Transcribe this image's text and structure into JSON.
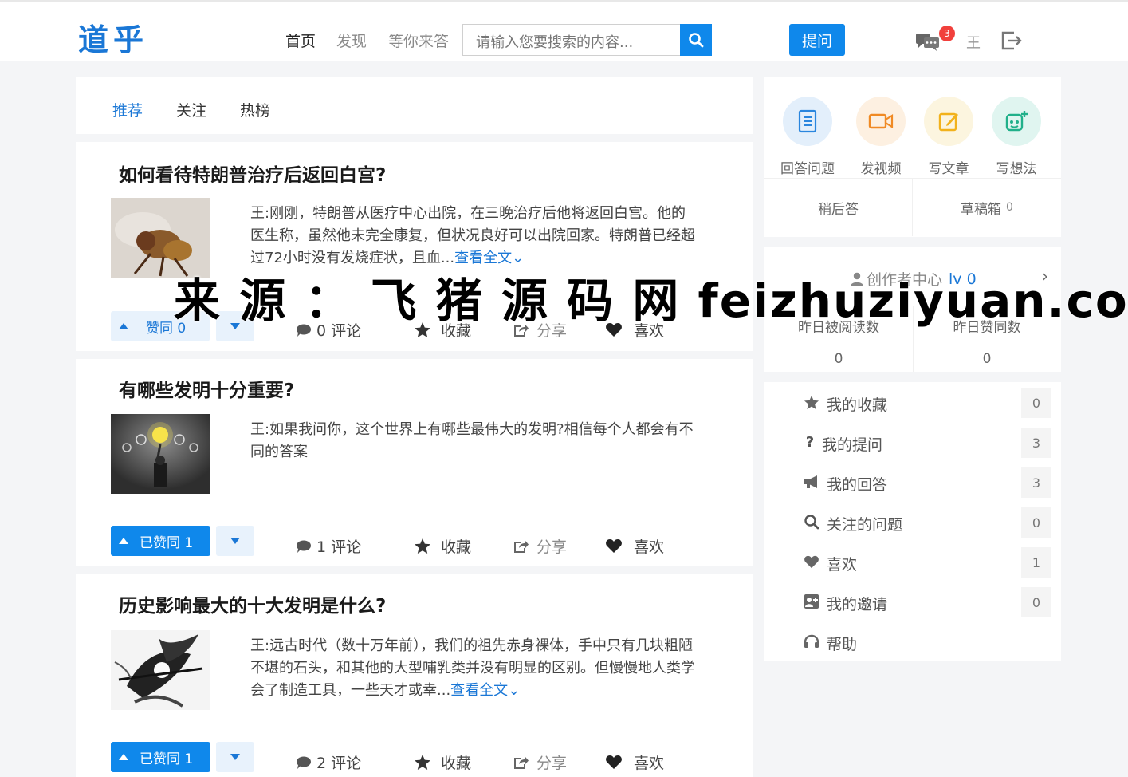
{
  "header": {
    "logo": "道乎",
    "nav": [
      "首页",
      "发现",
      "等你来答"
    ],
    "search_placeholder": "请输入您要搜索的内容...",
    "ask_label": "提问",
    "message_count": "3",
    "user_name": "王"
  },
  "tabs": [
    "推荐",
    "关注",
    "热榜"
  ],
  "questions": [
    {
      "title": "如何看待特朗普治疗后返回白宫?",
      "excerpt": "王:刚刚，特朗普从医疗中心出院，在三晚治疗后他将返回白宫。他的医生称，虽然他未完全康复，但状况良好可以出院回家。特朗普已经超过72小时没有发烧症状，且血...",
      "read_more": "查看全文",
      "vote_label": "赞同 0",
      "comments": "0 评论",
      "collect": "收藏",
      "share": "分享",
      "like": "喜欢"
    },
    {
      "title": "有哪些发明十分重要?",
      "excerpt": "王:如果我问你，这个世界上有哪些最伟大的发明?相信每个人都会有不同的答案",
      "read_more": "",
      "vote_label": "已赞同 1",
      "comments": "1 评论",
      "collect": "收藏",
      "share": "分享",
      "like": "喜欢"
    },
    {
      "title": "历史影响最大的十大发明是什么?",
      "excerpt": "王:远古时代（数十万年前），我们的祖先赤身裸体，手中只有几块粗陋不堪的石头，和其他的大型哺乳类并没有明显的区别。但慢慢地人类学会了制造工具，一些天才或幸...",
      "read_more": "查看全文",
      "vote_label": "已赞同 1",
      "comments": "2 评论",
      "collect": "收藏",
      "share": "分享",
      "like": "喜欢"
    }
  ],
  "sidebar": {
    "create": [
      "回答问题",
      "发视频",
      "写文章",
      "写想法"
    ],
    "later_answer": "稍后答",
    "drafts": "草稿箱",
    "drafts_count": "0",
    "creator_center": "创作者中心",
    "creator_level": "lv 0",
    "stats": [
      {
        "label": "昨日被阅读数",
        "value": "0"
      },
      {
        "label": "昨日赞同数",
        "value": "0"
      }
    ],
    "menu": [
      {
        "label": "我的收藏",
        "count": "0",
        "icon": "star-icon"
      },
      {
        "label": "我的提问",
        "count": "3",
        "icon": "question-icon"
      },
      {
        "label": "我的回答",
        "count": "3",
        "icon": "bullhorn-icon"
      },
      {
        "label": "关注的问题",
        "count": "0",
        "icon": "search-icon"
      },
      {
        "label": "喜欢",
        "count": "1",
        "icon": "heart-icon"
      },
      {
        "label": "我的邀请",
        "count": "0",
        "icon": "invite-icon"
      },
      {
        "label": "帮助",
        "count": "",
        "icon": "headphones-icon"
      }
    ]
  },
  "watermark": "来 源 ： 飞 猪 源 码 网 feizhuziyuan.com"
}
